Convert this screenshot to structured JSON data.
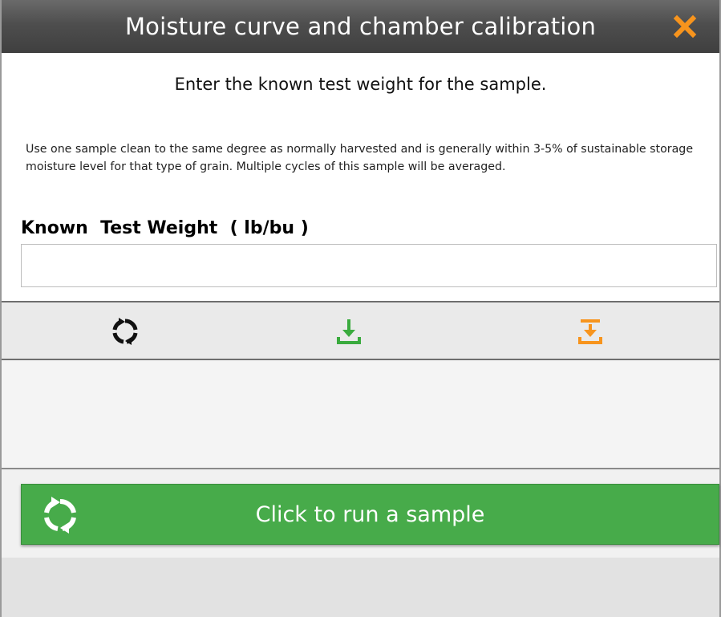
{
  "window": {
    "title": "Moisture curve and chamber calibration",
    "close_icon": "close-icon",
    "accent_color": "#f7941d"
  },
  "main": {
    "prompt": "Enter the known test weight for the sample.",
    "description": "Use one sample clean to the same degree as normally harvested and is generally within 3-5% of sustainable storage moisture level for that type of grain. Multiple cycles of this sample will be averaged.",
    "field_label": "Known  Test Weight  ( lb/bu )",
    "field_value": ""
  },
  "toolbar": {
    "items": [
      {
        "icon": "refresh-icon",
        "color": "#111111"
      },
      {
        "icon": "download-icon",
        "color": "#3aab3e"
      },
      {
        "icon": "upload-icon",
        "color": "#f7941d"
      }
    ]
  },
  "run": {
    "label": "Click to run a sample",
    "icon": "refresh-icon",
    "color": "#47ab4a"
  }
}
